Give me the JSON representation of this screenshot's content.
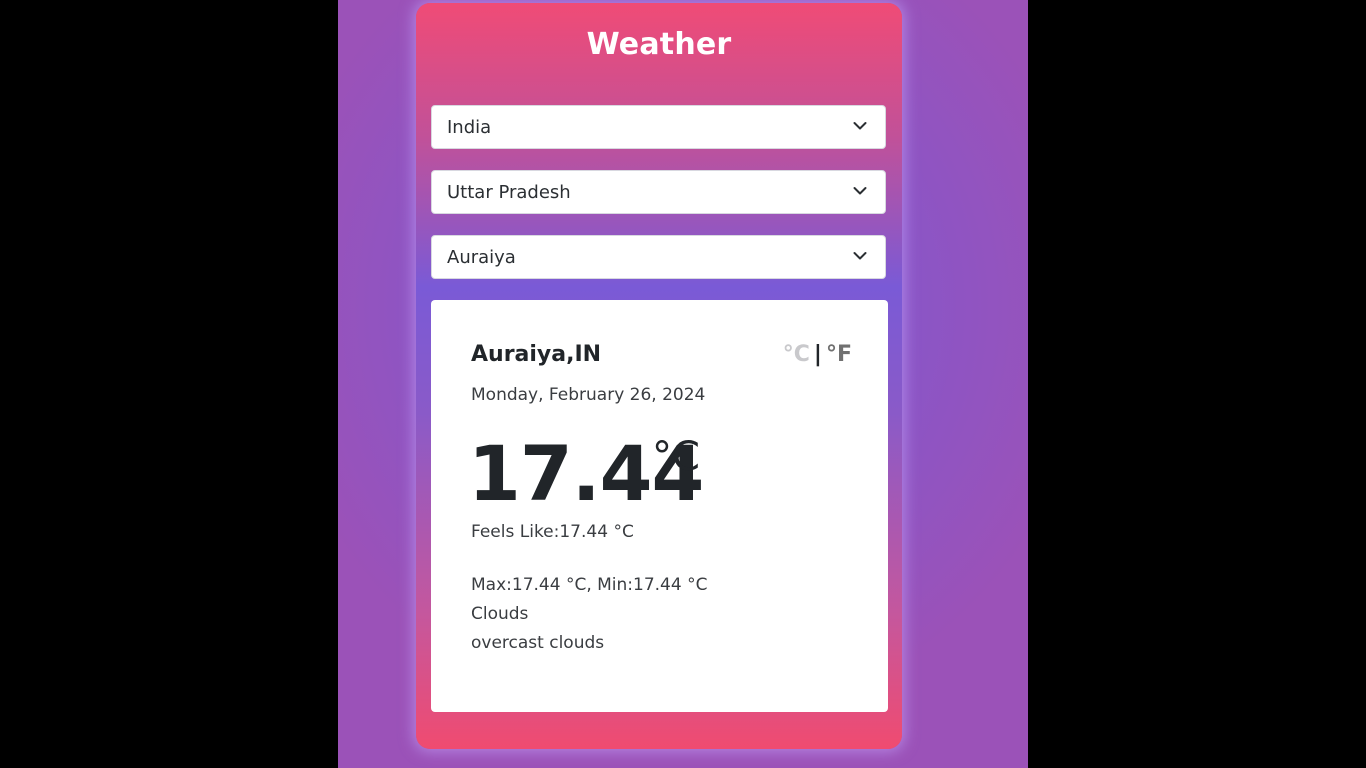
{
  "app": {
    "title": "Weather"
  },
  "selects": {
    "country": {
      "value": "India",
      "icon": "chevron-down-icon"
    },
    "state": {
      "value": "Uttar Pradesh",
      "icon": "chevron-down-icon"
    },
    "city": {
      "value": "Auraiya",
      "icon": "chevron-down-icon"
    }
  },
  "weather": {
    "location": "Auraiya,IN",
    "units": {
      "celsius": "°C",
      "separator": "|",
      "fahrenheit": "°F"
    },
    "date": "Monday, February 26, 2024",
    "temperature": "17.44",
    "temperature_unit": "°C",
    "feels_like": "Feels Like:17.44 °C",
    "max_min": "Max:17.44 °C, Min:17.44 °C",
    "condition": "Clouds",
    "description": "overcast clouds"
  },
  "colors": {
    "background_black": "#000000",
    "page_gradient_center": "#6a5be0",
    "card_gradient_top": "#f04b76",
    "card_gradient_mid": "#7a5ad6",
    "panel_bg": "#ffffff",
    "text_dark": "#212529",
    "unit_inactive": "#c9c9cc"
  }
}
